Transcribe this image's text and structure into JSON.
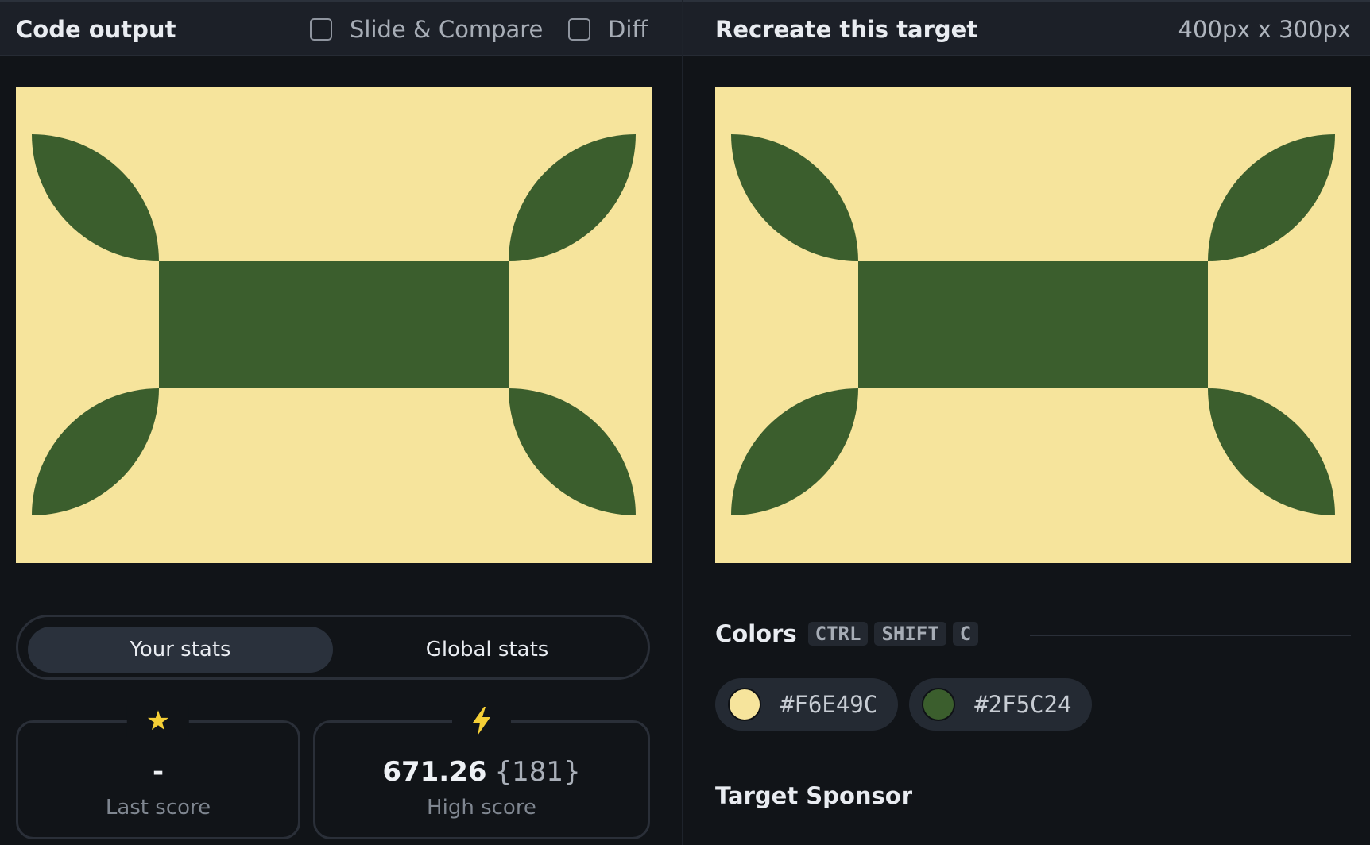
{
  "left": {
    "title": "Code output",
    "slide_compare_label": "Slide & Compare",
    "diff_label": "Diff",
    "tabs": {
      "your_stats": "Your stats",
      "global_stats": "Global stats"
    },
    "stats": {
      "last": {
        "icon": "star-icon",
        "value": "-",
        "label": "Last score"
      },
      "high": {
        "icon": "lightning-icon",
        "value": "671.26",
        "sub": "{181}",
        "label": "High score"
      }
    }
  },
  "right": {
    "title": "Recreate this target",
    "dimensions": "400px x 300px",
    "colors_title": "Colors",
    "shortcut_keys": [
      "CTRL",
      "SHIFT",
      "C"
    ],
    "colors": [
      {
        "hex": "#F6E49C",
        "value": "#f6e49c"
      },
      {
        "hex": "#2F5C24",
        "value": "#2f5c24"
      }
    ],
    "sponsor_title": "Target Sponsor"
  },
  "canvas": {
    "background": "#f6e49c",
    "shape_color": "#3b5e2d"
  }
}
